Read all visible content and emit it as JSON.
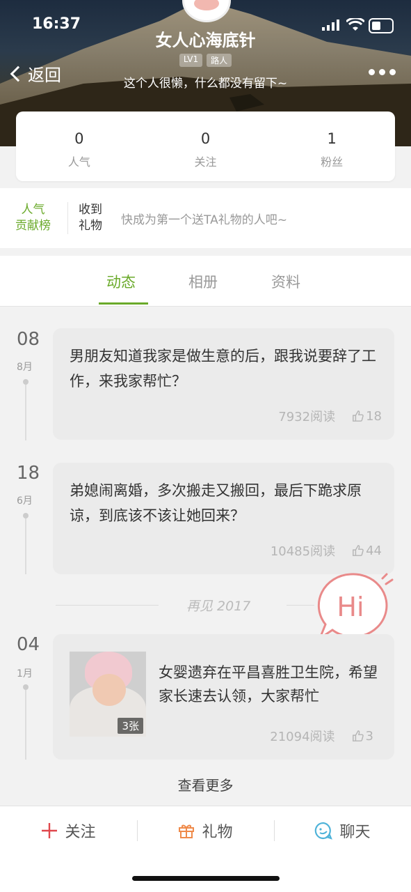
{
  "status_bar": {
    "time": "16:37"
  },
  "profile": {
    "username": "女人心海底针",
    "level_badge": "LV1",
    "role_badge": "路人",
    "bio": "这个人很懒，什么都没有留下~",
    "back_label": "返回"
  },
  "stats": [
    {
      "value": "0",
      "label": "人气"
    },
    {
      "value": "0",
      "label": "关注"
    },
    {
      "value": "1",
      "label": "粉丝"
    }
  ],
  "gift_rank": {
    "rank_label_line1": "人气",
    "rank_label_line2": "贡献榜",
    "received_line1": "收到",
    "received_line2": "礼物",
    "hint": "快成为第一个送TA礼物的人吧~"
  },
  "tabs": [
    {
      "label": "动态",
      "active": true
    },
    {
      "label": "相册",
      "active": false
    },
    {
      "label": "资料",
      "active": false
    }
  ],
  "posts": [
    {
      "day": "08",
      "month": "8月",
      "text": "男朋友知道我家是做生意的后，跟我说要辞了工作，来我家帮忙？",
      "reads": "7932阅读",
      "likes": "18"
    },
    {
      "day": "18",
      "month": "6月",
      "text": "弟媳闹离婚，多次搬走又搬回，最后下跪求原谅，到底该不该让她回来？",
      "reads": "10485阅读",
      "likes": "44"
    },
    {
      "day": "04",
      "month": "1月",
      "text": "女婴遗弃在平昌喜胜卫生院，希望家长速去认领，大家帮忙",
      "reads": "21094阅读",
      "likes": "3",
      "photo_count": "3张"
    }
  ],
  "year_divider": "再见 2017",
  "hi_bubble": "Hi",
  "see_more": "查看更多",
  "actions": [
    {
      "label": "关注",
      "icon": "plus-icon",
      "color": "#e0474c"
    },
    {
      "label": "礼物",
      "icon": "gift-icon",
      "color": "#ef8a4a"
    },
    {
      "label": "聊天",
      "icon": "chat-icon",
      "color": "#4fb3d9"
    }
  ],
  "accent_color": "#6aaa2a"
}
